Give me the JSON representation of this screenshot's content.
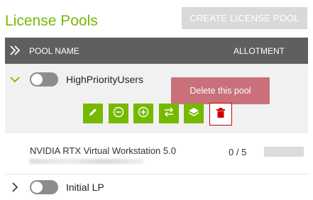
{
  "header": {
    "title": "License Pools",
    "create_button_label": "CREATE LICENSE POOL"
  },
  "table": {
    "columns": {
      "pool_name": "POOL NAME",
      "allotment": "ALLOTMENT"
    }
  },
  "pools": [
    {
      "name": "HighPriorityUsers",
      "expanded": true,
      "enabled": false,
      "actions": [
        "edit-icon",
        "minus-circle-icon",
        "plus-circle-icon",
        "transfer-icon",
        "layers-icon",
        "trash-icon"
      ],
      "tooltip": "Delete this pool",
      "features": [
        {
          "name": "NVIDIA RTX Virtual Workstation 5.0",
          "allotment": "0 / 5",
          "allotment_fraction": 0
        }
      ]
    },
    {
      "name": "Initial LP",
      "expanded": false,
      "enabled": false
    }
  ],
  "colors": {
    "accent": "#76b900",
    "header_bg": "#5f5f5f",
    "tooltip_bg": "#c9707a",
    "delete_border": "#cc0000"
  }
}
